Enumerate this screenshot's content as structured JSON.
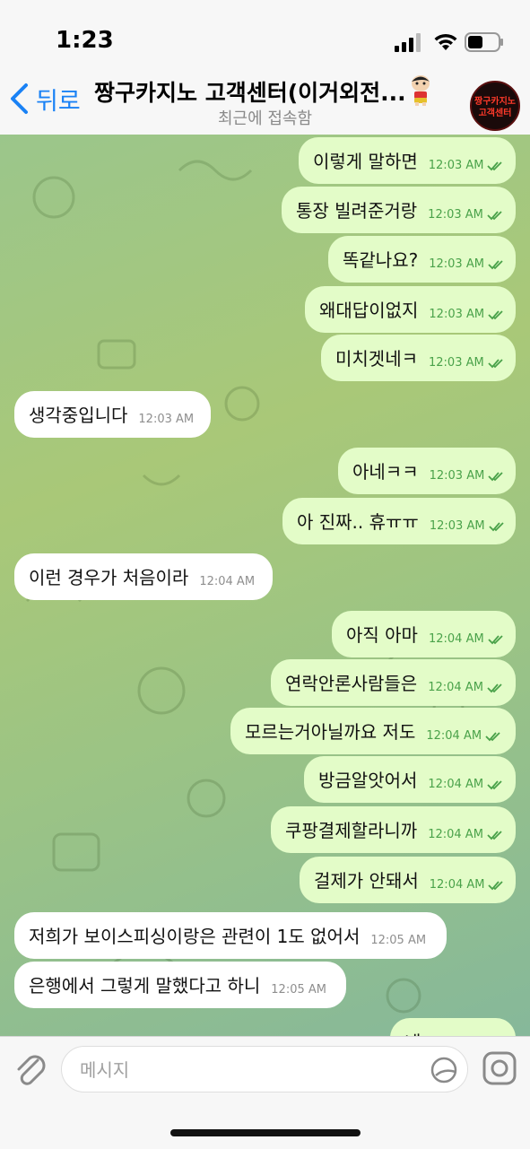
{
  "status": {
    "time": "1:23"
  },
  "header": {
    "back_label": "뒤로",
    "title": "짱구카지노 고객센터(이거외전...",
    "subtitle": "최근에 접속함",
    "avatar_text_1": "짱구카지노",
    "avatar_text_2": "고객센터"
  },
  "messages": [
    {
      "dir": "out",
      "text": "이렇게 말하면",
      "time": "12:03 AM"
    },
    {
      "dir": "out",
      "text": "통장 빌려준거랑",
      "time": "12:03 AM"
    },
    {
      "dir": "out",
      "text": "똑같나요?",
      "time": "12:03 AM"
    },
    {
      "dir": "out",
      "text": "왜대답이없지",
      "time": "12:03 AM"
    },
    {
      "dir": "out",
      "text": "미치겟네ㅋ",
      "time": "12:03 AM"
    },
    {
      "dir": "in",
      "text": "생각중입니다",
      "time": "12:03 AM"
    },
    {
      "dir": "out",
      "text": "아네ㅋㅋ",
      "time": "12:03 AM"
    },
    {
      "dir": "out",
      "text": "아 진짜.. 휴ㅠㅠ",
      "time": "12:03 AM"
    },
    {
      "dir": "in",
      "text": "이런 경우가 처음이라",
      "time": "12:04 AM"
    },
    {
      "dir": "out",
      "text": "아직 아마",
      "time": "12:04 AM"
    },
    {
      "dir": "out",
      "text": "연락안론사람들은",
      "time": "12:04 AM"
    },
    {
      "dir": "out",
      "text": "모르는거아닐까요 저도",
      "time": "12:04 AM"
    },
    {
      "dir": "out",
      "text": "방금알앗어서",
      "time": "12:04 AM"
    },
    {
      "dir": "out",
      "text": "쿠팡결제할라니까",
      "time": "12:04 AM"
    },
    {
      "dir": "out",
      "text": "걸제가 안돼서",
      "time": "12:04 AM"
    },
    {
      "dir": "in",
      "text": "저희가 보이스피싱이랑은 관련이 1도 없어서",
      "time": "12:05 AM"
    },
    {
      "dir": "in",
      "text": "은행에서 그렇게 말했다고 하니",
      "time": "12:05 AM"
    },
    {
      "dir": "out",
      "text": "네",
      "time": ""
    }
  ],
  "input": {
    "placeholder": "메시지"
  }
}
